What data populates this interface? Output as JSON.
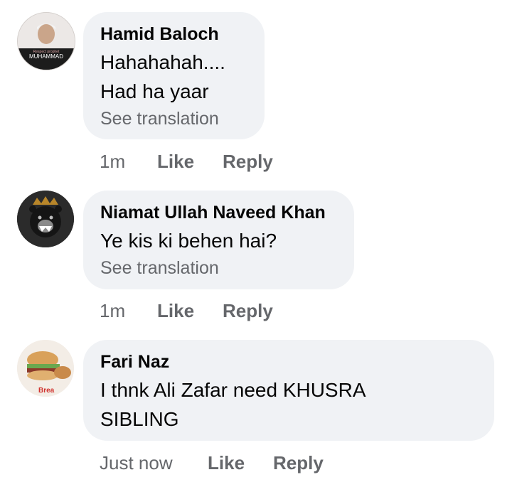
{
  "comments": [
    {
      "author": "Hamid Baloch",
      "lines": [
        "Hahahahah....",
        "Had  ha yaar"
      ],
      "see_translation": "See translation",
      "time": "1m",
      "like": "Like",
      "reply": "Reply",
      "avatar": {
        "icon": "profile-photo-avatar",
        "overlay_text": "MUHAMMAD",
        "overlay_subtext": "Respect prophet"
      }
    },
    {
      "author": "Niamat Ullah Naveed Khan",
      "lines": [
        "Ye kis ki behen hai?"
      ],
      "see_translation": "See translation",
      "time": "1m",
      "like": "Like",
      "reply": "Reply",
      "avatar": {
        "icon": "crowned-bear-avatar"
      }
    },
    {
      "author": "Fari Naz",
      "lines": [
        "I thnk Ali Zafar need KHUSRA",
        "SIBLING"
      ],
      "time": "Just now",
      "like": "Like",
      "reply": "Reply",
      "avatar": {
        "icon": "food-burger-avatar",
        "overlay_text": "Brea"
      }
    }
  ],
  "colors": {
    "bubble": "#f0f2f5",
    "secondary_text": "#65676b",
    "primary_text": "#050505"
  }
}
